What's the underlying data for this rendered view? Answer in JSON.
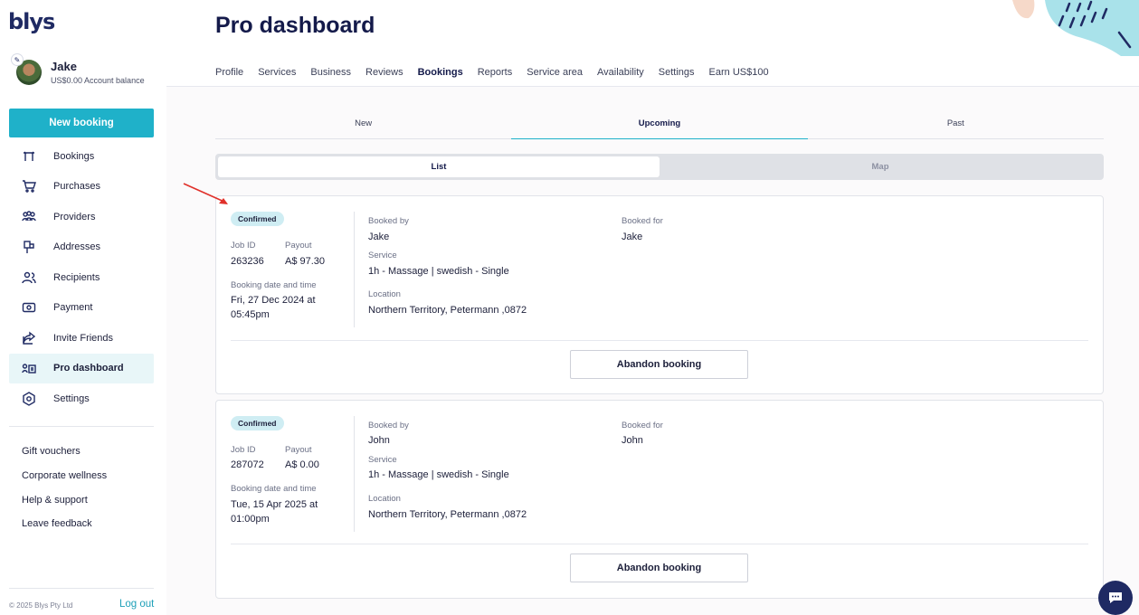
{
  "brand": {
    "logo": "blys"
  },
  "profile": {
    "name": "Jake",
    "balance": "US$0.00 Account balance"
  },
  "sidebar": {
    "new_booking": "New booking",
    "items": [
      {
        "label": "Bookings",
        "icon": "bookings-icon"
      },
      {
        "label": "Purchases",
        "icon": "cart-icon"
      },
      {
        "label": "Providers",
        "icon": "people-icon"
      },
      {
        "label": "Addresses",
        "icon": "mailbox-icon"
      },
      {
        "label": "Recipients",
        "icon": "users-icon"
      },
      {
        "label": "Payment",
        "icon": "payment-icon"
      },
      {
        "label": "Invite Friends",
        "icon": "share-icon"
      },
      {
        "label": "Pro dashboard",
        "icon": "pro-dashboard-icon",
        "active": true
      },
      {
        "label": "Settings",
        "icon": "gear-icon"
      }
    ],
    "links": [
      "Gift vouchers",
      "Corporate wellness",
      "Help & support",
      "Leave feedback"
    ],
    "copyright": "© 2025 Blys Pty Ltd",
    "logout": "Log out"
  },
  "header": {
    "title": "Pro dashboard",
    "tabs": [
      "Profile",
      "Services",
      "Business",
      "Reviews",
      "Bookings",
      "Reports",
      "Service area",
      "Availability",
      "Settings",
      "Earn US$100"
    ],
    "active_tab": "Bookings"
  },
  "booking_tabs": [
    "New",
    "Upcoming",
    "Past"
  ],
  "active_booking_tab": "Upcoming",
  "view_toggle": [
    "List",
    "Map"
  ],
  "active_view": "List",
  "labels": {
    "job_id": "Job ID",
    "payout": "Payout",
    "booking_date": "Booking date and time",
    "booked_by": "Booked by",
    "booked_for": "Booked for",
    "service": "Service",
    "location": "Location",
    "abandon": "Abandon booking"
  },
  "bookings": [
    {
      "status": "Confirmed",
      "job_id": "263236",
      "payout": "A$ 97.30",
      "date_line1": "Fri, 27 Dec 2024 at",
      "date_line2": "05:45pm",
      "booked_by": "Jake",
      "booked_for": "Jake",
      "service": "1h - Massage | swedish - Single",
      "location": "Northern Territory, Petermann ,0872"
    },
    {
      "status": "Confirmed",
      "job_id": "287072",
      "payout": "A$ 0.00",
      "date_line1": "Tue, 15 Apr 2025 at",
      "date_line2": "01:00pm",
      "booked_by": "John",
      "booked_for": "John",
      "service": "1h - Massage | swedish - Single",
      "location": "Northern Territory, Petermann ,0872"
    }
  ],
  "colors": {
    "accent": "#1fb1c9",
    "brand": "#1f2a63",
    "annotation_arrow": "#e0302a"
  }
}
